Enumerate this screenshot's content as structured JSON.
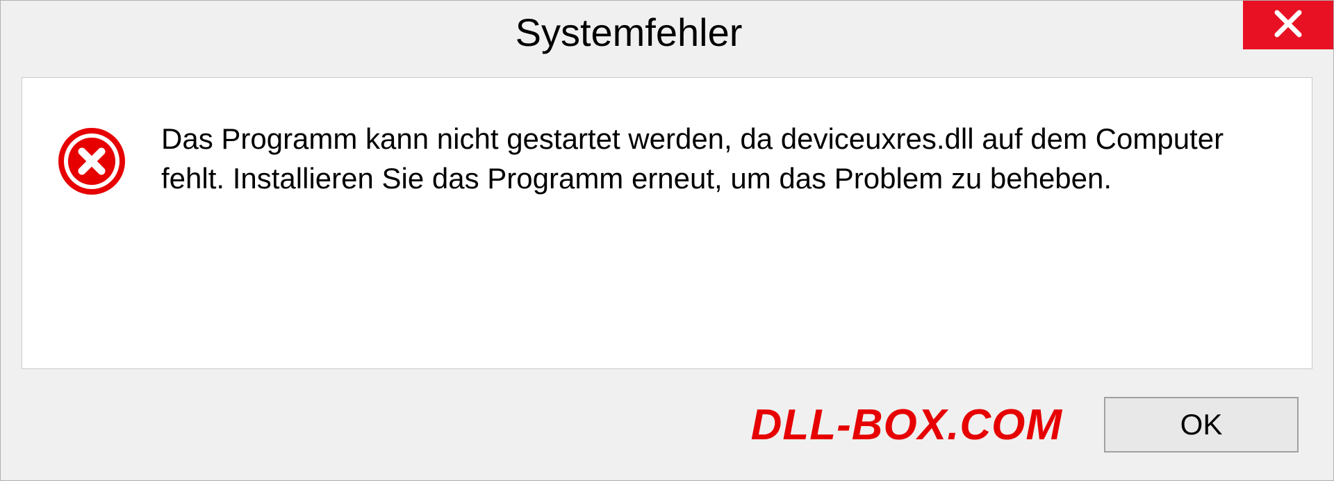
{
  "dialog": {
    "title": "Systemfehler",
    "message": "Das Programm kann nicht gestartet werden, da deviceuxres.dll auf dem Computer fehlt. Installieren Sie das Programm erneut, um das Problem zu beheben.",
    "ok_label": "OK"
  },
  "watermark": "DLL-BOX.COM"
}
